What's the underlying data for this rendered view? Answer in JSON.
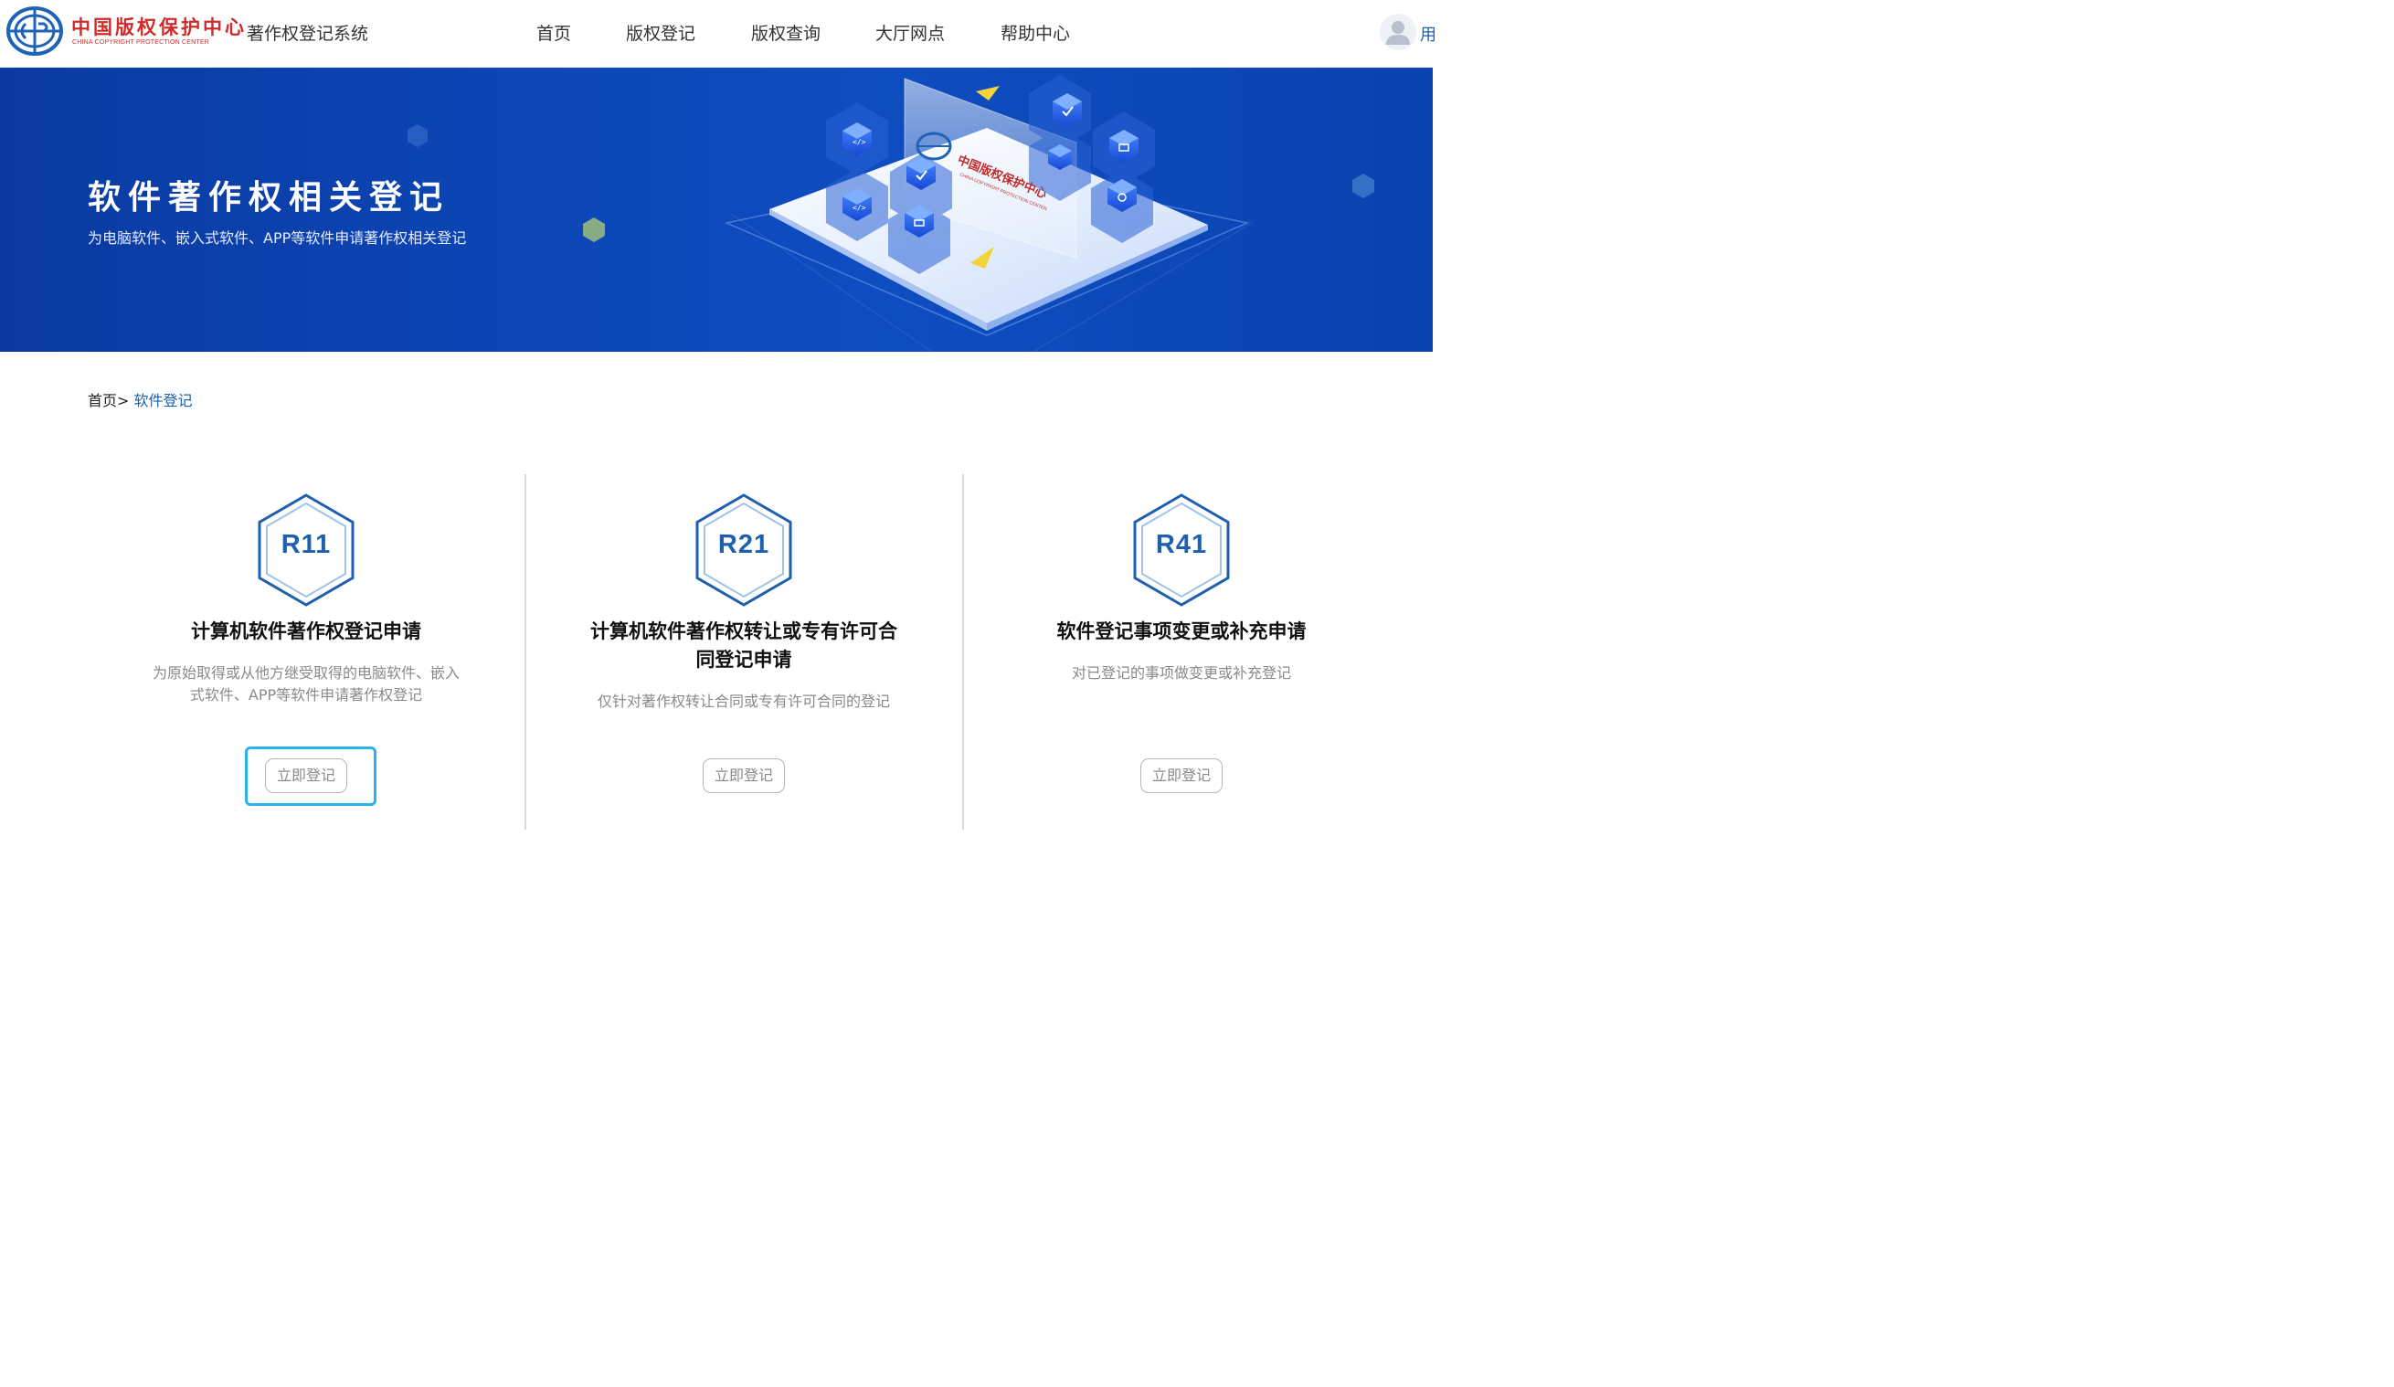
{
  "header": {
    "logo_cn": "中国版权保护中心",
    "logo_en": "CHINA COPYRIGHT PROTECTION CENTER",
    "system_title": "著作权登记系统",
    "nav": [
      "首页",
      "版权登记",
      "版权查询",
      "大厅网点",
      "帮助中心"
    ],
    "user_text": "用",
    "accent_color": "#1a5fb4"
  },
  "banner": {
    "title": "软件著作权相关登记",
    "subtitle": "为电脑软件、嵌入式软件、APP等软件申请著作权相关登记",
    "background_color": "#0d47b8",
    "illustration_logo_text": "中国版权保护中心",
    "illustration_logo_en": "CHINA COPYRIGHT PROTECTION CENTER"
  },
  "breadcrumb": {
    "home": "首页",
    "separator": ">",
    "current": "软件登记"
  },
  "cards": [
    {
      "code": "R11",
      "title": "计算机软件著作权登记申请",
      "description_lines": [
        "为原始取得或从他方继受取得的电脑软件、嵌入",
        "式软件、APP等软件申请著作权登记"
      ],
      "button": "立即登记",
      "focused": true
    },
    {
      "code": "R21",
      "title_lines": [
        "计算机软件著作权转让或专有许可合",
        "同登记申请"
      ],
      "description_lines": [
        "仅针对著作权转让合同或专有许可合同的登记"
      ],
      "button": "立即登记",
      "focused": false
    },
    {
      "code": "R41",
      "title": "软件登记事项变更或补充申请",
      "description_lines": [
        "对已登记的事项做变更或补充登记"
      ],
      "button": "立即登记",
      "focused": false
    }
  ],
  "colors": {
    "hex_stroke": "#1e5fae",
    "focus_ring": "#2ab1ee",
    "logo_red": "#d02a2a"
  }
}
